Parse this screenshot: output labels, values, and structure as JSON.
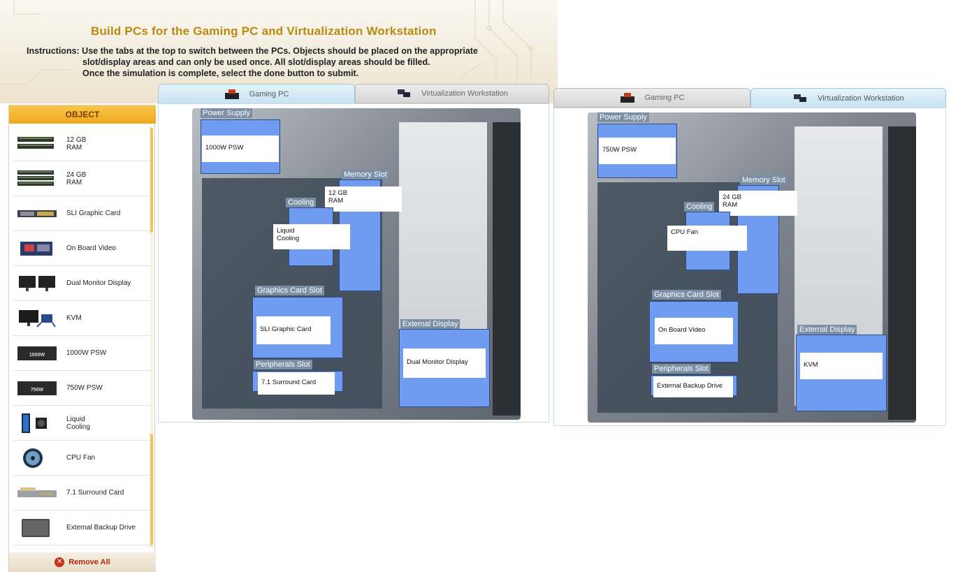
{
  "title": "Build PCs for the Gaming PC and Virtualization Workstation",
  "instructions": {
    "line1": "Instructions: Use the tabs at the top to switch between the PCs. Objects should be placed on the appropriate",
    "line2": "slot/display areas and can only be used once. All slot/display areas should be filled.",
    "line3": "Once the simulation is complete, select the done button to submit."
  },
  "sidebar": {
    "header": "OBJECT",
    "items": [
      {
        "label": "12 GB\nRAM",
        "icon": "ram-icon"
      },
      {
        "label": "24 GB\nRAM",
        "icon": "ram-icon"
      },
      {
        "label": "SLI Graphic Card",
        "icon": "graphic-card-icon"
      },
      {
        "label": "On Board Video",
        "icon": "video-card-icon"
      },
      {
        "label": "Dual Monitor Display",
        "icon": "dual-monitor-icon"
      },
      {
        "label": "KVM",
        "icon": "kvm-icon"
      },
      {
        "label": "1000W PSW",
        "icon": "psu-icon",
        "badge": "1000W"
      },
      {
        "label": "750W PSW",
        "icon": "psu-icon",
        "badge": "750W"
      },
      {
        "label": "Liquid\nCooling",
        "icon": "liquid-cooling-icon"
      },
      {
        "label": "CPU Fan",
        "icon": "cpu-fan-icon"
      },
      {
        "label": "7.1 Surround Card",
        "icon": "sound-card-icon"
      },
      {
        "label": "External Backup Drive",
        "icon": "hard-drive-icon"
      }
    ],
    "remove_all": "Remove All"
  },
  "tabs": {
    "gaming": "Gaming PC",
    "workstation": "Virtualization Workstation"
  },
  "labels": {
    "power_supply": "Power Supply",
    "memory_slot": "Memory Slot",
    "cooling": "Cooling",
    "graphics_card_slot": "Graphics Card Slot",
    "peripherals_slot": "Peripherals Slot",
    "external_display": "External Display"
  },
  "gaming_pc": {
    "power_supply": "1000W PSW",
    "memory": "12 GB\nRAM",
    "cooling": "Liquid\nCooling",
    "graphics": "SLI Graphic Card",
    "peripherals": "7.1 Surround Card",
    "display": "Dual Monitor Display"
  },
  "workstation": {
    "power_supply": "750W PSW",
    "memory": "24 GB\nRAM",
    "cooling": "CPU Fan",
    "graphics": "On Board Video",
    "peripherals": "External Backup Drive",
    "display": "KVM"
  },
  "colors": {
    "accent": "#f0a81c",
    "title": "#b98a11",
    "slot_fill": "#6f9cf0",
    "tab_active": "#c6e3f2"
  }
}
